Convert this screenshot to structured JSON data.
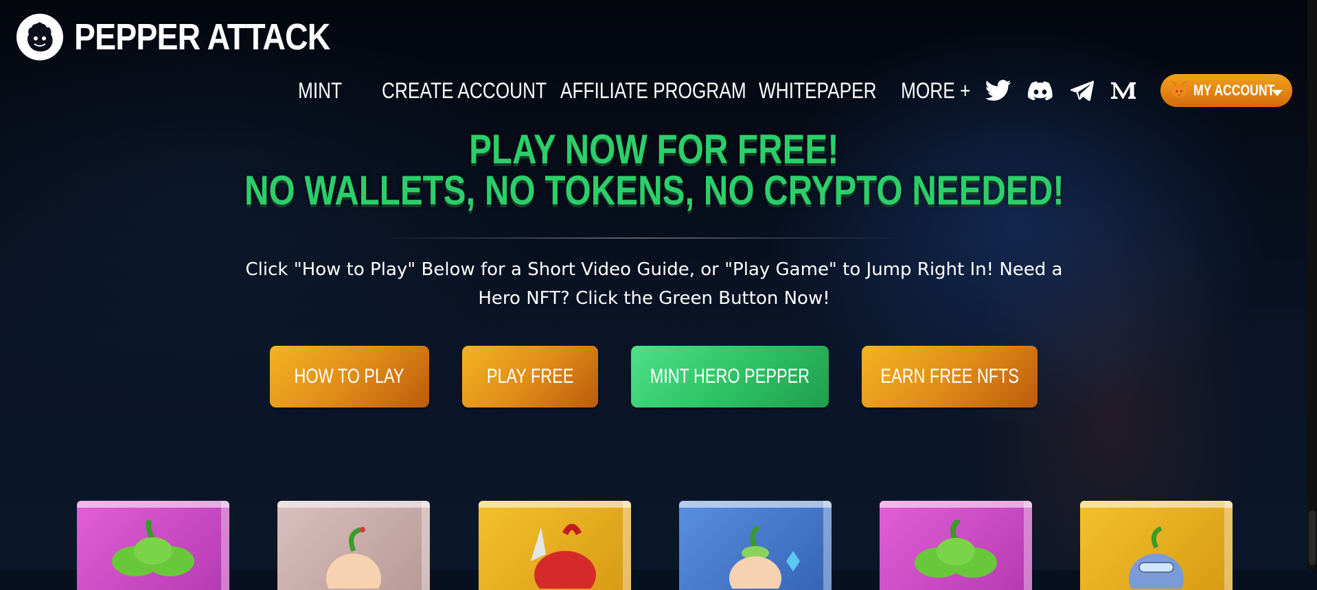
{
  "brand": {
    "name": "PEPPER ATTACK",
    "icon": "pepper-logo-icon"
  },
  "nav": {
    "links": [
      "MINT",
      "CREATE ACCOUNT",
      "AFFILIATE PROGRAM",
      "WHITEPAPER",
      "MORE +"
    ],
    "social": [
      "twitter-icon",
      "discord-icon",
      "telegram-icon",
      "medium-icon"
    ],
    "account_label": "MY ACCOUNT"
  },
  "hero": {
    "headline_1": "PLAY NOW FOR FREE!",
    "headline_2": "NO WALLETS, NO TOKENS, NO CRYPTO NEEDED!",
    "intro": "Click \"How to Play\" Below for a Short Video Guide, or \"Play Game\" to Jump Right In! Need a Hero NFT? Click the Green Button Now!"
  },
  "buttons": {
    "how_to_play": "HOW TO PLAY",
    "play_free": "PLAY FREE",
    "mint_hero": "MINT HERO PEPPER",
    "earn_nfts": "EARN FREE NFTS"
  },
  "colors": {
    "headline_green": "#2bcf6a",
    "button_orange": "#e08d18",
    "button_green": "#2fc466",
    "background": "#07101f"
  }
}
